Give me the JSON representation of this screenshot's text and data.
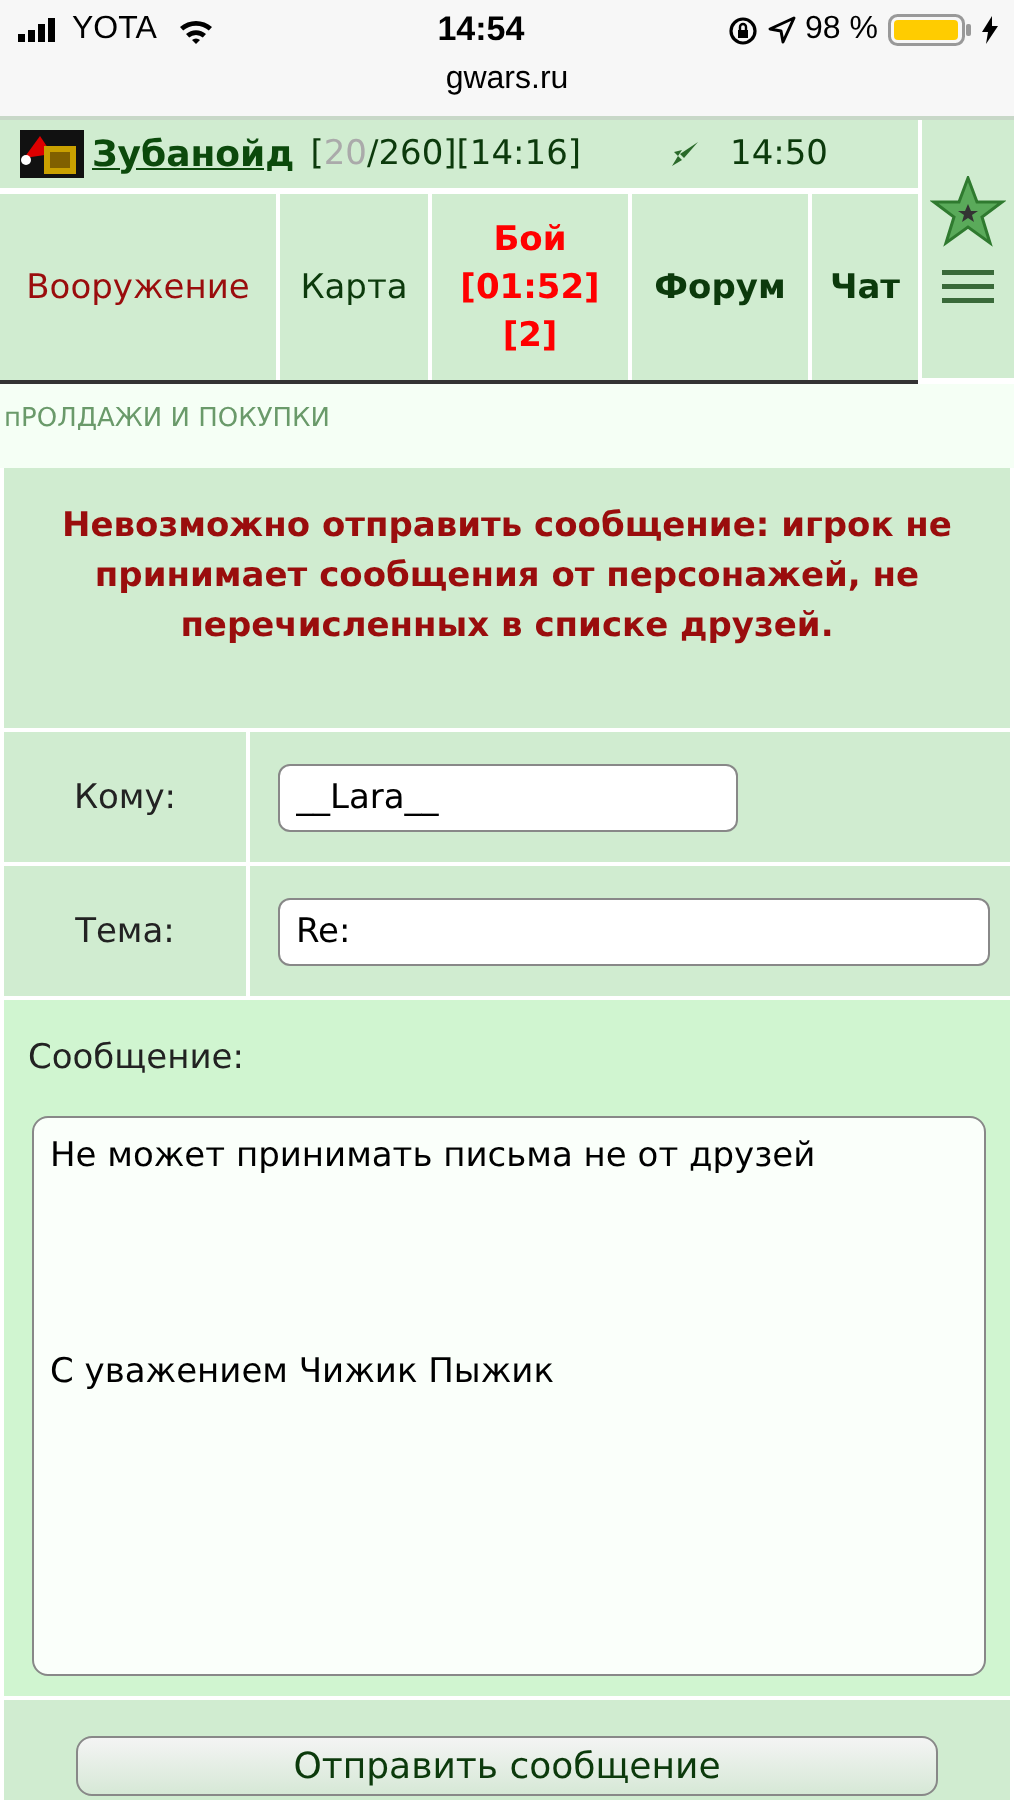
{
  "status_bar": {
    "carrier": "YOTA",
    "time": "14:54",
    "battery": "98 %"
  },
  "address_bar": {
    "url": "gwars.ru"
  },
  "header": {
    "player": "Зубанойд",
    "stats": [
      {
        "text": "[",
        "dim": false
      },
      {
        "text": "20",
        "dim": true
      },
      {
        "text": "/260][14:16]",
        "dim": false
      }
    ],
    "server_time": "14:50"
  },
  "nav": [
    {
      "label": "Вооружение",
      "kind": "current"
    },
    {
      "label": "Карта",
      "kind": "plain"
    },
    {
      "label": "Бой [01:52] [2]",
      "kind": "alert"
    },
    {
      "label": "Форум",
      "kind": "bold"
    },
    {
      "label": "Чат",
      "kind": "bold"
    }
  ],
  "section_title": "пРОЛДАЖИ И ПОКУПКИ",
  "error": "Невозможно отправить сообщение: игрок не принимает сообщения от персонажей, не перечисленных в списке друзей.",
  "form": {
    "to_label": "Кому:",
    "to_value": "__Lara__",
    "subject_label": "Тема:",
    "subject_value": "Re:",
    "message_label": "Сообщение:",
    "message_value": "Не может принимать письма не от друзей\n\n\n\nС уважением Чижик Пыжик",
    "submit": "Отправить сообщение"
  }
}
